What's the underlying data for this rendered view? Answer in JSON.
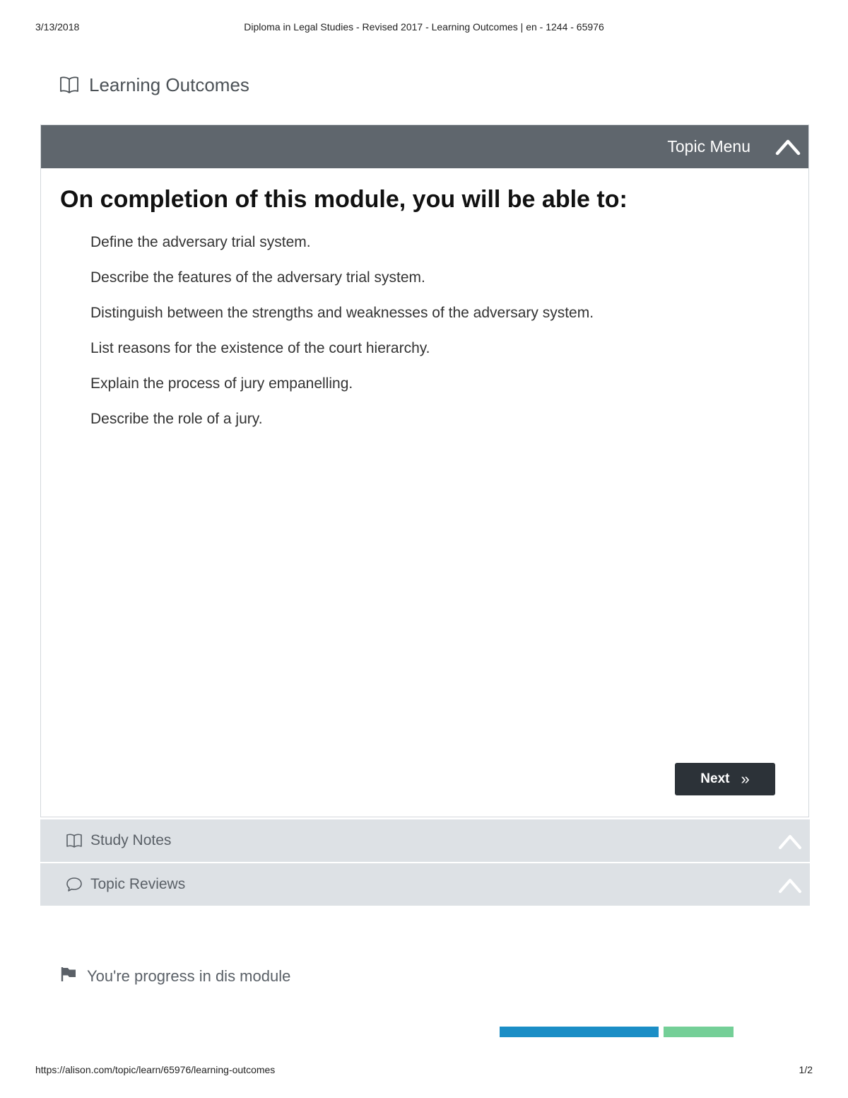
{
  "print_header": {
    "date": "3/13/2018",
    "title": "Diploma in Legal Studies - Revised 2017 - Learning Outcomes | en - 1244 - 65976"
  },
  "page": {
    "heading": "Learning Outcomes",
    "heading_icon": "book-icon"
  },
  "topic_bar": {
    "label": "Topic Menu",
    "icon": "chevron-up-icon"
  },
  "content": {
    "heading": "On completion of this module, you will be able to:",
    "outcomes": [
      "Define the adversary trial system.",
      "Describe the features of the adversary trial system.",
      "Distinguish between the strengths and weaknesses of the adversary system.",
      "List reasons for the existence of the court hierarchy.",
      "Explain the process of jury empanelling.",
      "Describe the role of a jury."
    ]
  },
  "next_button": {
    "label": "Next",
    "icon": "double-chevron-right-icon"
  },
  "accordions": [
    {
      "label": "Study Notes",
      "icon": "book-icon"
    },
    {
      "label": "Topic Reviews",
      "icon": "speech-bubble-icon"
    }
  ],
  "progress": {
    "heading": "You're progress in dis module",
    "icon": "flag-icon",
    "segment_a_fraction": 0.68,
    "segment_b_fraction": 0.3,
    "colors": {
      "segment_a": "#1b8ec6",
      "segment_b": "#74cf97"
    }
  },
  "print_footer": {
    "url": "https://alison.com/topic/learn/65976/learning-outcomes",
    "page_number": "1/2"
  },
  "colors": {
    "topic_bar": "#5f666d",
    "accordion": "#dde1e5",
    "next_button": "#2c3238"
  }
}
